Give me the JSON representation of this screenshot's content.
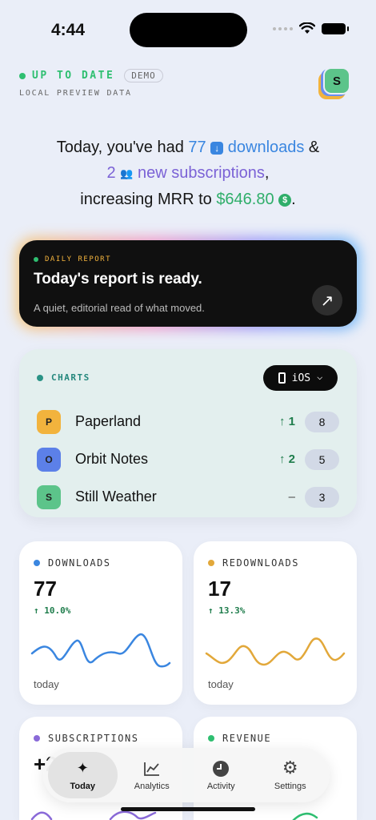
{
  "status": {
    "time": "4:44"
  },
  "sync": {
    "status": "UP TO DATE",
    "badge": "DEMO",
    "subtitle": "LOCAL PREVIEW DATA"
  },
  "account": {
    "initial": "S"
  },
  "headline": {
    "l1_pre": "Today, you've had ",
    "downloads_count": "77",
    "downloads_icon": "↓",
    "downloads_word": "downloads",
    "l1_post": " &",
    "subs_count": "2",
    "subs_icon": "👥",
    "subs_word": "new subscriptions",
    "l2_post": ",",
    "l3_pre": "increasing MRR to ",
    "mrr": "$646.80",
    "mrr_icon": "$",
    "l3_post": "."
  },
  "report": {
    "kicker": "DAILY REPORT",
    "title": "Today's report is ready.",
    "subtitle": "A quiet, editorial read of what moved.",
    "button_icon": "↗"
  },
  "charts": {
    "label": "CHARTS",
    "platform": "iOS",
    "platform_chevron": "⌵",
    "apps": [
      {
        "initial": "P",
        "name": "Paperland",
        "delta": "↑ 1",
        "rank": "8",
        "color": "#f2b33d"
      },
      {
        "initial": "O",
        "name": "Orbit Notes",
        "delta": "↑ 2",
        "rank": "5",
        "color": "#5c80e8"
      },
      {
        "initial": "S",
        "name": "Still Weather",
        "delta": "–",
        "rank": "3",
        "color": "#5cc48a"
      }
    ]
  },
  "metrics": [
    {
      "label": "DOWNLOADS",
      "value": "77",
      "change": "↑ 10.0%",
      "footer": "today",
      "color": "#3a86e0"
    },
    {
      "label": "REDOWNLOADS",
      "value": "17",
      "change": "↑ 13.3%",
      "footer": "today",
      "color": "#e2a83a"
    },
    {
      "label": "SUBSCRIPTIONS",
      "value": "+2",
      "color": "#8a6ad8"
    },
    {
      "label": "REVENUE",
      "color": "#2fbf71"
    }
  ],
  "tabs": [
    {
      "label": "Today",
      "icon": "✦",
      "active": true
    },
    {
      "label": "Analytics",
      "icon": "📈",
      "active": false
    },
    {
      "label": "Activity",
      "icon": "🕘",
      "active": false
    },
    {
      "label": "Settings",
      "icon": "⚙",
      "active": false
    }
  ]
}
